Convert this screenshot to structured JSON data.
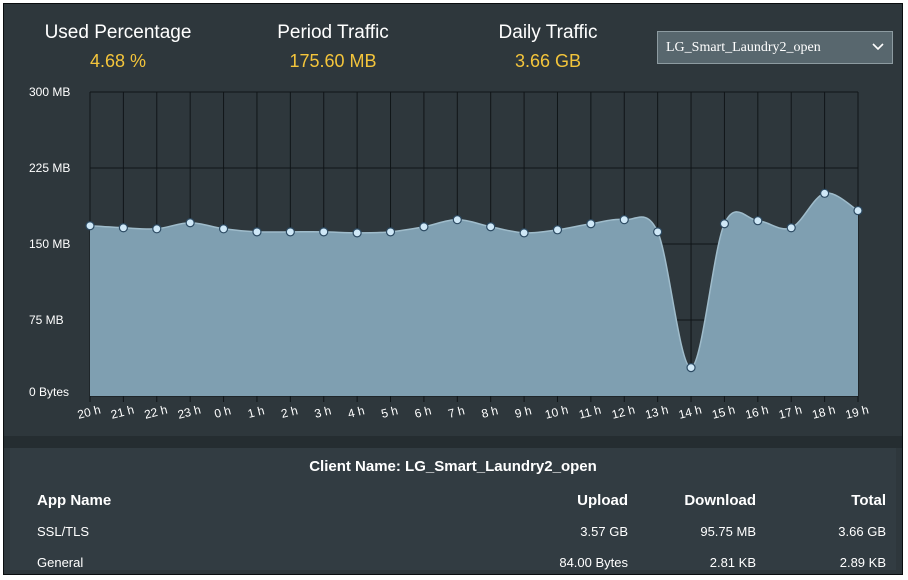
{
  "stats": {
    "used_percentage": {
      "label": "Used Percentage",
      "value": "4.68 %"
    },
    "period_traffic": {
      "label": "Period Traffic",
      "value": "175.60 MB"
    },
    "daily_traffic": {
      "label": "Daily Traffic",
      "value": "3.66 GB"
    }
  },
  "client_select": {
    "value": "LG_Smart_Laundry2_open"
  },
  "chart_data": {
    "type": "area",
    "y_ticks": [
      "300 MB",
      "225 MB",
      "150 MB",
      "75 MB",
      "0 Bytes"
    ],
    "ylim": [
      0,
      300
    ],
    "y_unit": "MB",
    "categories": [
      "20 h",
      "21 h",
      "22 h",
      "23 h",
      "0 h",
      "1 h",
      "2 h",
      "3 h",
      "4 h",
      "5 h",
      "6 h",
      "7 h",
      "8 h",
      "9 h",
      "10 h",
      "11 h",
      "12 h",
      "13 h",
      "14 h",
      "15 h",
      "16 h",
      "17 h",
      "18 h",
      "19 h"
    ],
    "values": [
      168,
      166,
      165,
      171,
      165,
      162,
      162,
      162,
      161,
      162,
      167,
      174,
      167,
      161,
      164,
      170,
      174,
      162,
      28,
      170,
      173,
      166,
      200,
      183
    ],
    "grid": true,
    "fill_color": "#7f9fb1",
    "line_color": "#9fbccb",
    "point_color": "#cfe8f7"
  },
  "apps_table": {
    "title": "Client Name: LG_Smart_Laundry2_open",
    "headers": {
      "name": "App Name",
      "upload": "Upload",
      "download": "Download",
      "total": "Total"
    },
    "rows": [
      {
        "name": "SSL/TLS",
        "upload": "3.57 GB",
        "download": "95.75 MB",
        "total": "3.66 GB"
      },
      {
        "name": "General",
        "upload": "84.00 Bytes",
        "download": "2.81 KB",
        "total": "2.89 KB"
      }
    ]
  }
}
